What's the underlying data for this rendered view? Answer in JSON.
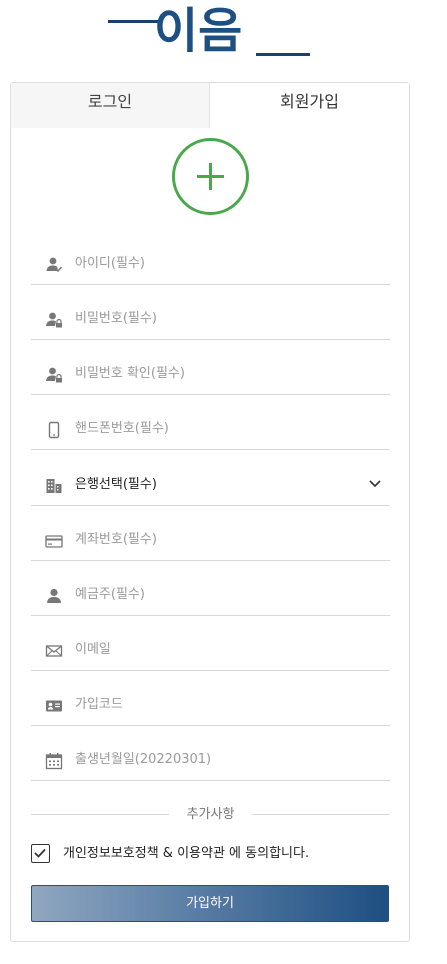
{
  "logo": {
    "text": "이음"
  },
  "tabs": [
    {
      "label": "로그인",
      "active": false
    },
    {
      "label": "회원가입",
      "active": true
    }
  ],
  "profile": {
    "add_icon": "plus-circle-icon",
    "color": "#4aa84c"
  },
  "form": {
    "fields": [
      {
        "icon": "user-check-icon",
        "placeholder": "아이디(필수)"
      },
      {
        "icon": "user-lock-icon",
        "placeholder": "비밀번호(필수)"
      },
      {
        "icon": "user-lock-icon",
        "placeholder": "비밀번호 확인(필수)"
      },
      {
        "icon": "phone-icon",
        "placeholder": "핸드폰번호(필수)"
      },
      {
        "icon": "building-icon",
        "value": "은행선택(필수)",
        "type": "select"
      },
      {
        "icon": "credit-card-icon",
        "placeholder": "계좌번호(필수)"
      },
      {
        "icon": "user-icon",
        "placeholder": "예금주(필수)"
      },
      {
        "icon": "mail-icon",
        "placeholder": "이메일"
      },
      {
        "icon": "id-card-icon",
        "placeholder": "가입코드"
      },
      {
        "icon": "calendar-icon",
        "placeholder": "출생년월일(20220301)"
      }
    ],
    "section_divider": "추가사항",
    "agreement": {
      "checked": true,
      "label": "개인정보보호정책 & 이용약관 에 동의합니다."
    },
    "submit_label": "가입하기"
  },
  "colors": {
    "brand": "#1d4f82",
    "accent_green": "#4aa84c",
    "icon_gray": "#777777"
  }
}
